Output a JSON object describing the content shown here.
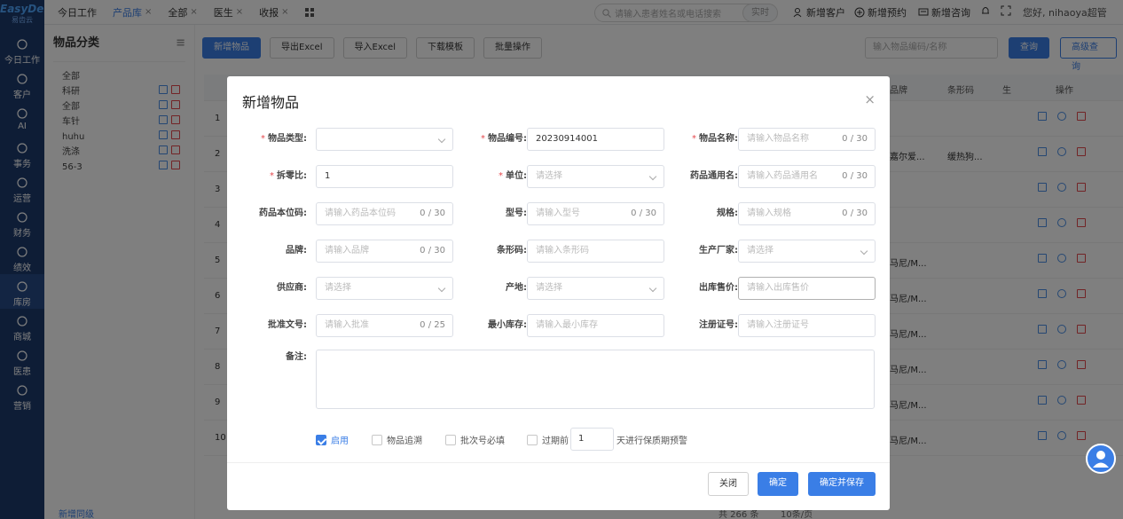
{
  "brand": {
    "logo_line1": "EasyDent",
    "logo_line2": "易齿云"
  },
  "nav": [
    {
      "label": "今日工作",
      "icon": "home-icon"
    },
    {
      "label": "客户",
      "icon": "user-icon"
    },
    {
      "label": "AI",
      "icon": "ai-icon"
    },
    {
      "label": "事务",
      "icon": "task-icon"
    },
    {
      "label": "运营",
      "icon": "operate-icon"
    },
    {
      "label": "财务",
      "icon": "finance-icon"
    },
    {
      "label": "绩效",
      "icon": "chart-icon"
    },
    {
      "label": "库房",
      "icon": "warehouse-icon"
    },
    {
      "label": "商城",
      "icon": "cart-icon"
    },
    {
      "label": "医患",
      "icon": "patients-icon"
    },
    {
      "label": "营销",
      "icon": "marketing-icon"
    }
  ],
  "tabs": {
    "t1": "今日工作",
    "t2": "产品库",
    "t3": "全部",
    "t4": "医生",
    "t5": "收报",
    "close": "×"
  },
  "topbar": {
    "search_placeholder": "请输入患者姓名或电话搜索",
    "realtime": "实时",
    "new_customer": "新增客户",
    "new_appointment": "新增预约",
    "new_consult": "新增咨询",
    "greeting": "您好, nihaoya超管"
  },
  "cat": {
    "title": "物品分类",
    "items": [
      "全部",
      "科研",
      "全部",
      "车针",
      "huhu",
      "洗涤",
      "56-3"
    ]
  },
  "toolbar": {
    "add": "新增物品",
    "export": "导出Excel",
    "import": "导入Excel",
    "download": "下载模板",
    "batch": "批量操作",
    "search_placeholder": "输入物品编码/名称",
    "query": "查询",
    "advanced": "高级查询"
  },
  "table": {
    "h_brand": "品牌",
    "h_barcode": "条形码",
    "h_ops": "操作",
    "h_sheng": "生",
    "rows": [
      {
        "no": "1",
        "brand": "",
        "bar": ""
      },
      {
        "no": "2",
        "brand": "嘉尔爱...",
        "bar": "缓热狗..."
      },
      {
        "no": "3",
        "brand": "",
        "bar": ""
      },
      {
        "no": "4",
        "brand": "",
        "bar": ""
      },
      {
        "no": "5",
        "brand": "马尼/M...",
        "bar": ""
      },
      {
        "no": "6",
        "brand": "马尼/M...",
        "bar": ""
      },
      {
        "no": "7",
        "brand": "马尼/M...",
        "bar": ""
      },
      {
        "no": "8",
        "brand": "马尼/M...",
        "bar": ""
      },
      {
        "no": "9",
        "brand": "马尼/M...",
        "bar": ""
      },
      {
        "no": "10",
        "brand": "马尼/M...",
        "bar": ""
      }
    ]
  },
  "pager": {
    "left": "新增同级",
    "total": "共 266 条",
    "pagesize": "10条/页"
  },
  "modal": {
    "title": "新增物品",
    "close": "×",
    "fields": {
      "type_label": "物品类型:",
      "code_label": "物品编号:",
      "code_value": "20230914001",
      "name_label": "物品名称:",
      "name_ph": "请输入物品名称",
      "name_cnt": "0 / 30",
      "ratio_label": "拆零比:",
      "ratio_value": "1",
      "unit_label": "单位:",
      "unit_ph": "请选择",
      "generic_label": "药品通用名:",
      "generic_ph": "请输入药品通用名",
      "generic_cnt": "0 / 30",
      "localcode_label": "药品本位码:",
      "localcode_ph": "请输入药品本位码",
      "localcode_cnt": "0 / 30",
      "model_label": "型号:",
      "model_ph": "请输入型号",
      "model_cnt": "0 / 30",
      "spec_label": "规格:",
      "spec_ph": "请输入规格",
      "spec_cnt": "0 / 30",
      "brand_label": "品牌:",
      "brand_ph": "请输入品牌",
      "brand_cnt": "0 / 30",
      "barcode_label": "条形码:",
      "barcode_ph": "请输入条形码",
      "maker_label": "生产厂家:",
      "maker_ph": "请选择",
      "supplier_label": "供应商:",
      "supplier_ph": "请选择",
      "origin_label": "产地:",
      "origin_ph": "请选择",
      "price_label": "出库售价:",
      "price_ph": "请输入出库售价",
      "approval_label": "批准文号:",
      "approval_ph": "请输入批准",
      "approval_cnt": "0 / 25",
      "minstock_label": "最小库存:",
      "minstock_ph": "请输入最小库存",
      "regno_label": "注册证号:",
      "regno_ph": "请输入注册证号",
      "memo_label": "备注:"
    },
    "checks": {
      "enable": "启用",
      "trace": "物品追溯",
      "batch": "批次号必填",
      "expire": "过期前",
      "days": "1",
      "tail": "天进行保质期预警"
    },
    "buttons": {
      "close": "关闭",
      "ok": "确定",
      "ok_save": "确定并保存"
    }
  }
}
